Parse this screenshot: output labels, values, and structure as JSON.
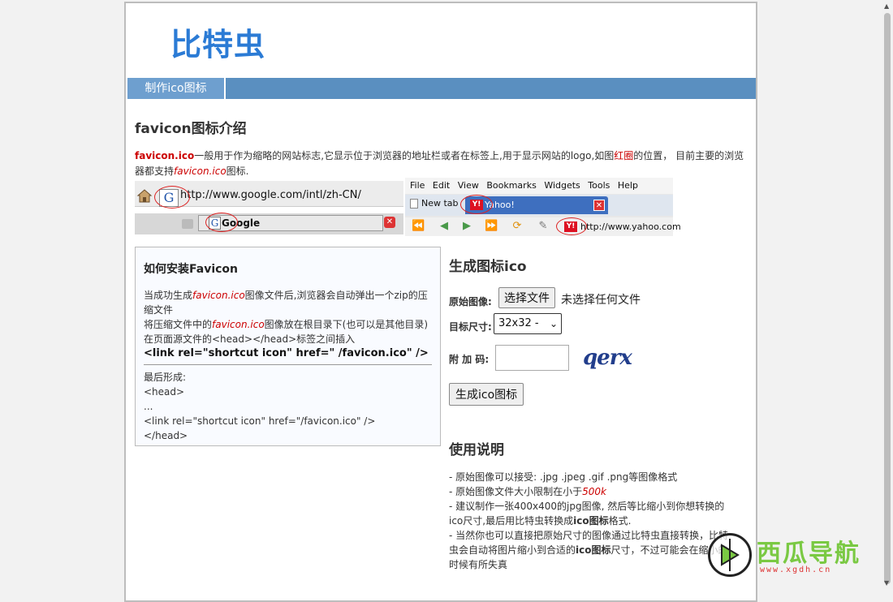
{
  "header": {
    "logo": "比特虫"
  },
  "nav": {
    "tab_label": "制作ico图标"
  },
  "intro": {
    "title": "favicon图标介绍",
    "lead": "favicon.ico",
    "text1": "一般用于作为缩略的网站标志,它显示位于浏览器的地址栏或者在标签上,用于显示网站的logo,如图",
    "red_circle": "红圈",
    "text2": "的位置， 目前主要的浏览器都支持",
    "italic_name": "favicon.ico",
    "text3": "图标."
  },
  "screenshot": {
    "google_url": "http://www.google.com/intl/zh-CN/",
    "google_tab": "Google",
    "google_icon": "G",
    "menu": [
      "File",
      "Edit",
      "View",
      "Bookmarks",
      "Widgets",
      "Tools",
      "Help"
    ],
    "new_tab": "New tab",
    "yahoo_tab": "Yahoo!",
    "yahoo_icon": "Y!",
    "yahoo_url": "http://www.yahoo.com"
  },
  "install": {
    "title": "如何安装Favicon",
    "l1a": "当成功生成",
    "l1b": "favicon.ico",
    "l1c": "图像文件后,浏览器会自动弹出一个zip的压缩文件",
    "l2a": "将压缩文件中的",
    "l2b": "favicon.ico",
    "l2c": "图像放在根目录下(也可以是其他目录)",
    "l3": "在页面源文件的<head></head>标签之间插入",
    "l4": "<link rel=\"shortcut icon\" href=\" /favicon.ico\" />",
    "l5": "最后形成:",
    "l6": "<head>",
    "l7": "...",
    "l8": "<link rel=\"shortcut icon\" href=\"/favicon.ico\" />",
    "l9": "</head>"
  },
  "form": {
    "title": "生成图标ico",
    "source_label": "原始图像:",
    "file_button": "选择文件",
    "no_file": "未选择任何文件",
    "size_label": "目标尺寸:",
    "size_value": "32x32 -",
    "code_label": "附 加 码:",
    "captcha": "qerx",
    "submit": "生成ico图标"
  },
  "usage": {
    "title": "使用说明",
    "i1": "- 原始图像可以接受: .jpg .jpeg .gif .png等图像格式",
    "i2a": "- 原始图像文件大小限制在小于",
    "i2b": "500k",
    "i3a": "- 建议制作一张400x400的jpg图像, 然后等比缩小到你想转换的ico尺寸,最后用比特虫转换成",
    "i3b": "ico图标",
    "i3c": "格式.",
    "i4a": "- 当然你也可以直接把原始尺寸的图像通过比特虫直接转换，比特虫会自动将图片缩小到合适的",
    "i4b": "ico图标",
    "i4c": "尺寸，不过可能会在缩小的时候有所失真"
  },
  "watermark": {
    "text": "西瓜导航",
    "url": "www.xgdh.cn"
  },
  "colors": {
    "brand": "#2b7bd5",
    "nav": "#5a8fc0",
    "accent_red": "#cc0000",
    "watermark_green": "#7ac943"
  }
}
